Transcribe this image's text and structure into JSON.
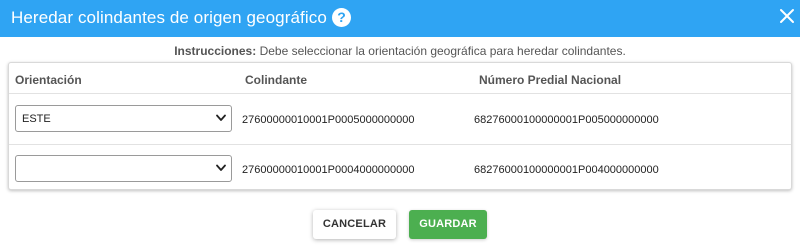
{
  "dialog": {
    "title": "Heredar colindantes de origen geográfico",
    "help_icon": "question-circle-icon",
    "help_glyph": "?",
    "close_icon": "close-icon"
  },
  "instructions": {
    "label": "Instrucciones:",
    "text": " Debe seleccionar la orientación geográfica para heredar colindantes."
  },
  "table": {
    "headers": [
      "Orientación",
      "Colindante",
      "Número Predial Nacional"
    ],
    "rows": [
      {
        "orientation": "ESTE",
        "colindante": "27600000010001P0005000000000",
        "numero_predial": "68276000100000001P005000000000"
      },
      {
        "orientation": "",
        "colindante": "27600000010001P0004000000000",
        "numero_predial": "68276000100000001P004000000000"
      }
    ]
  },
  "buttons": {
    "cancel": "CANCELAR",
    "save": "GUARDAR"
  },
  "colors": {
    "header": "#2fa4f3",
    "save_button": "#4caf50"
  }
}
